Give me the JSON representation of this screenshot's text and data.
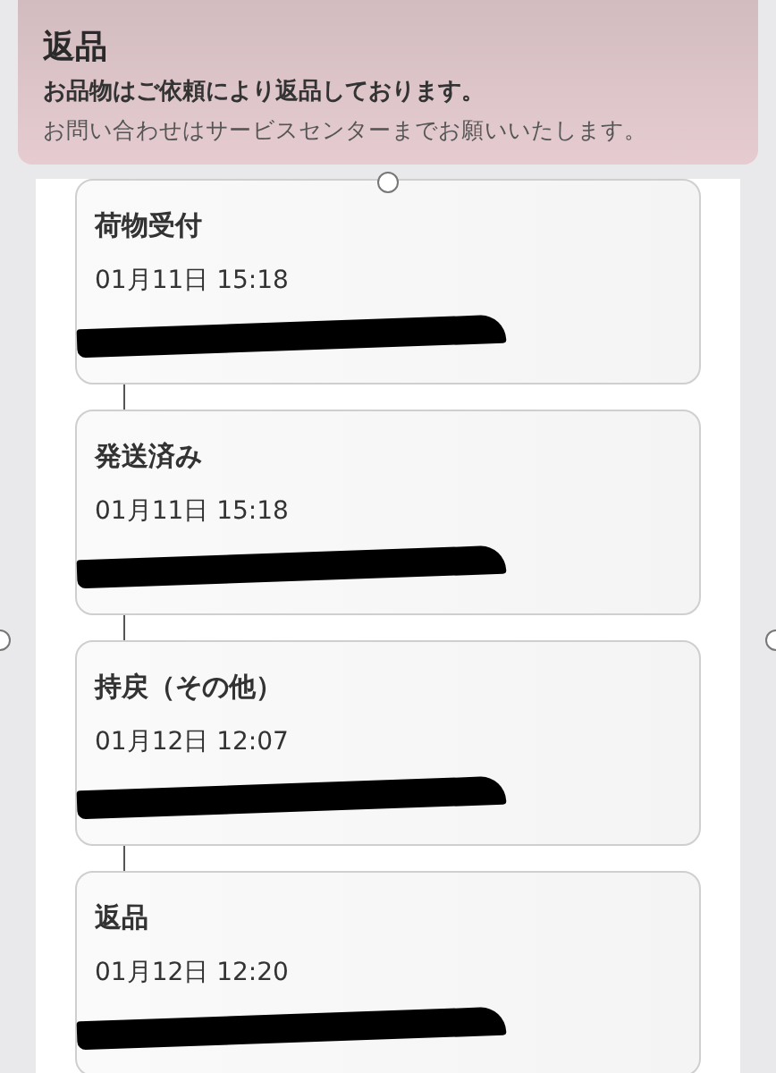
{
  "notice": {
    "title": "返品",
    "message": "お品物はご依頼により返品しております。",
    "note": "お問い合わせはサービスセンターまでお願いいたします。"
  },
  "events": [
    {
      "status": "荷物受付",
      "time": "01月11日 15:18"
    },
    {
      "status": "発送済み",
      "time": "01月11日 15:18"
    },
    {
      "status": "持戻（その他）",
      "time": "01月12日 12:07"
    },
    {
      "status": "返品",
      "time": "01月12日 12:20"
    }
  ]
}
